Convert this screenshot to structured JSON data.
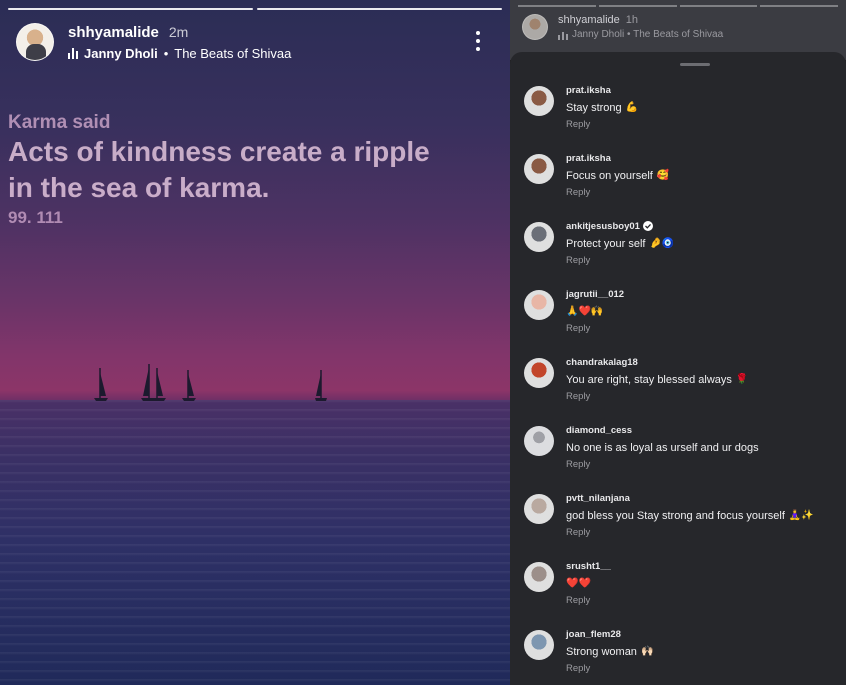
{
  "story": {
    "username": "shhyamalide",
    "time": "2m",
    "music_artist": "Janny Dholi",
    "music_separator": "•",
    "music_title": "The Beats of Shivaa",
    "quote_pre": "Karma said",
    "quote_line1": "Acts of kindness create a ripple",
    "quote_line2": "in the sea of karma.",
    "quote_number": "99. 111",
    "icons": [
      "music-bars-icon",
      "more-options-icon"
    ]
  },
  "panel": {
    "username": "shhyamalide",
    "time": "1h",
    "music": "Janny Dholi • The Beats of Shivaa",
    "reply_label": "Reply",
    "comments": [
      {
        "user": "prat.iksha",
        "text": "Stay strong",
        "emoji": "💪",
        "verified": false,
        "avatar": "#8a5a44"
      },
      {
        "user": "prat.iksha",
        "text": "Focus on yourself",
        "emoji": "🥰",
        "verified": false,
        "avatar": "#8a5a44"
      },
      {
        "user": "ankitjesusboy01",
        "text": "Protect your self",
        "emoji": "🤌🧿",
        "verified": true,
        "avatar": "#6b6f78"
      },
      {
        "user": "jagrutii__012",
        "text": "",
        "emoji": "🙏❤️🙌",
        "verified": false,
        "avatar": "#e8b6a6"
      },
      {
        "user": "chandrakalag18",
        "text": "You are right, stay blessed always",
        "emoji": "🌹",
        "verified": false,
        "avatar": "#c2452a"
      },
      {
        "user": "diamond_cess",
        "text": "No one is as loyal as urself and ur dogs",
        "emoji": "",
        "verified": false,
        "avatar": "#dcdde0"
      },
      {
        "user": "pvtt_nilanjana",
        "text": "god bless you Stay strong and focus yourself",
        "emoji": "🧘‍♀️✨",
        "verified": false,
        "avatar": "#b9a9a0"
      },
      {
        "user": "srusht1__",
        "text": "",
        "emoji": "❤️❤️",
        "verified": false,
        "avatar": "#9c8f8a"
      },
      {
        "user": "joan_flem28",
        "text": "Strong woman",
        "emoji": "🙌🏻",
        "verified": false,
        "avatar": "#7d96b0"
      }
    ]
  }
}
